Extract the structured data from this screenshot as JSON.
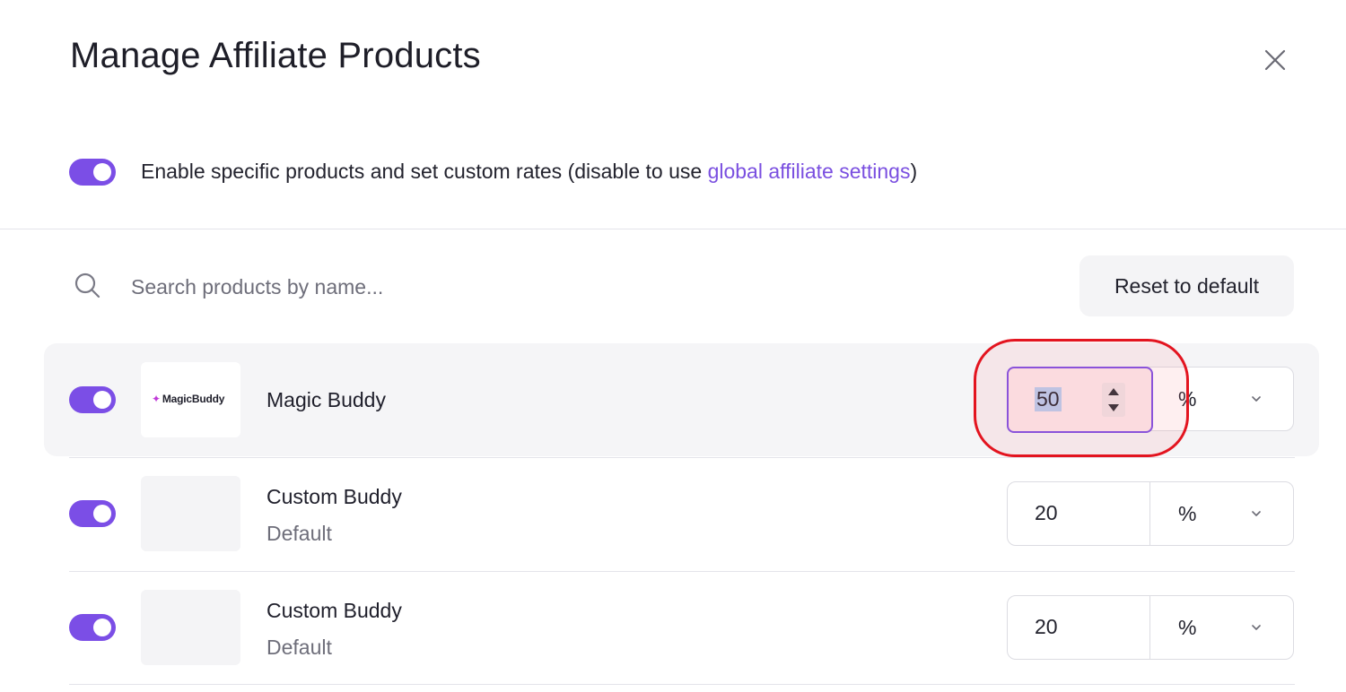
{
  "modal": {
    "title": "Manage Affiliate Products",
    "close_icon": "close-icon"
  },
  "enable": {
    "text": "Enable specific products and set custom rates (disable to use ",
    "link": "global affiliate settings",
    "suffix": ")",
    "enabled": true
  },
  "search": {
    "placeholder": "Search products by name...",
    "value": ""
  },
  "reset_label": "Reset to default",
  "products": [
    {
      "logo_text": "MagicBuddy",
      "name": "Magic Buddy",
      "subtitle": "",
      "enabled": true,
      "rate": "50",
      "unit": "%"
    },
    {
      "logo_text": "",
      "name": "Custom Buddy",
      "subtitle": "Default",
      "enabled": true,
      "rate": "20",
      "unit": "%"
    },
    {
      "logo_text": "",
      "name": "Custom Buddy",
      "subtitle": "Default",
      "enabled": true,
      "rate": "20",
      "unit": "%"
    }
  ],
  "colors": {
    "accent": "#7b4ee6",
    "link": "#7a4fe0",
    "highlight": "#e3141f"
  }
}
